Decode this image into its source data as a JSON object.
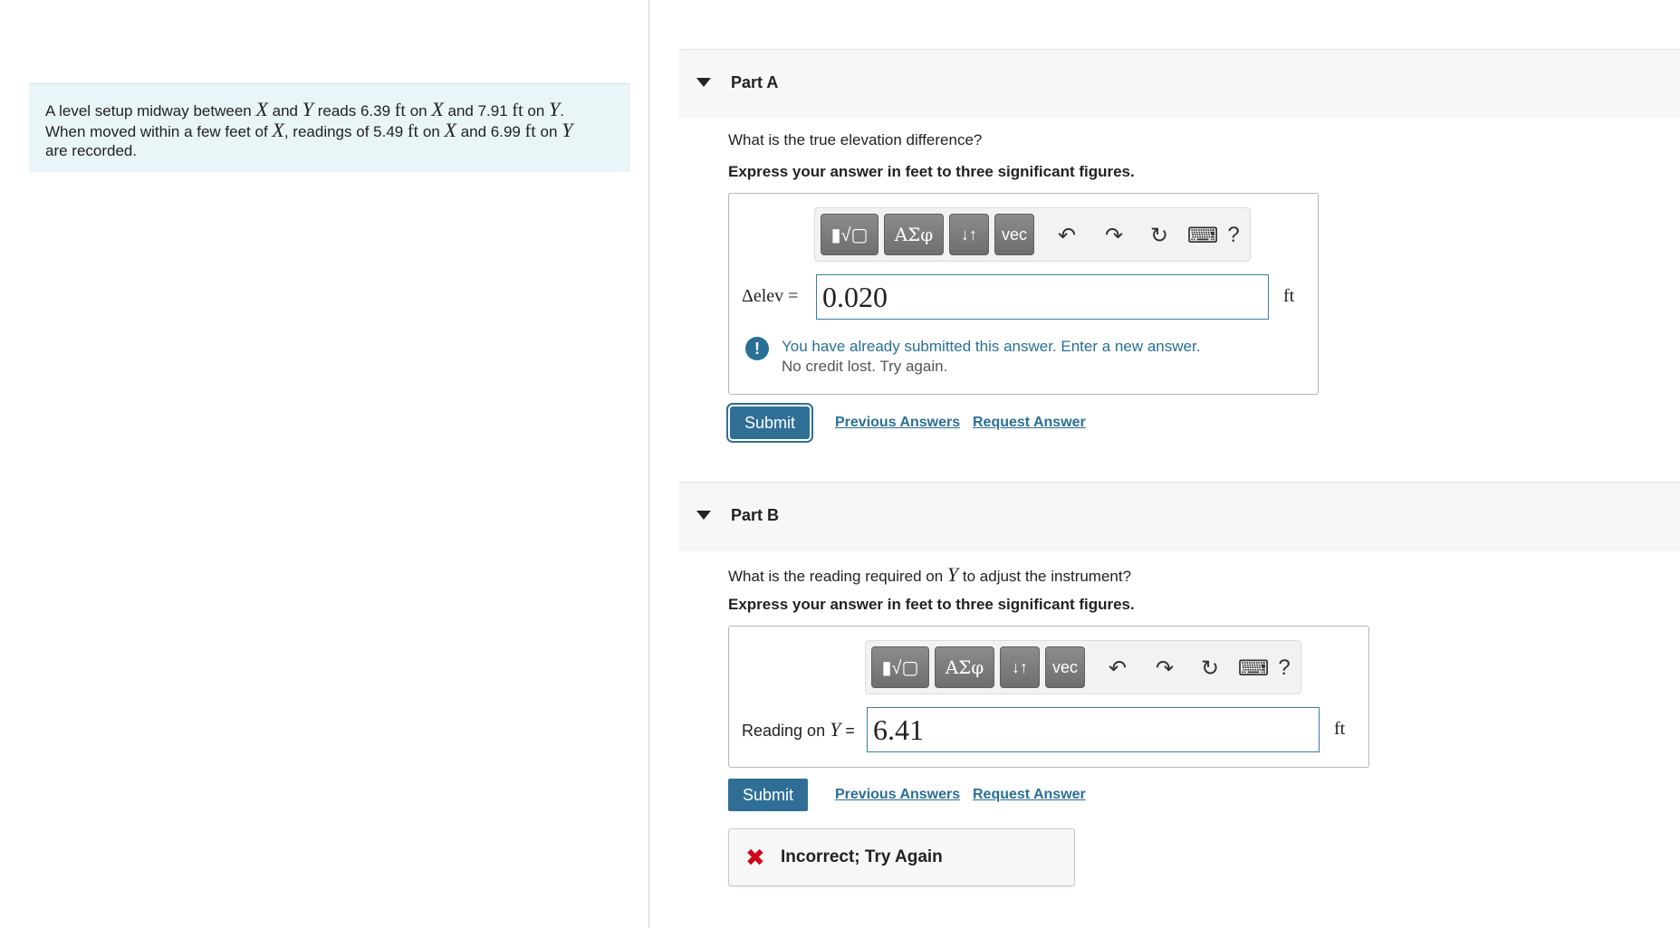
{
  "problem": {
    "t1": "A level setup midway between ",
    "X": "X",
    "t2": " and ",
    "Y": "Y",
    "t3": " reads 6.39 ",
    "ft": "ft",
    "t4": " on ",
    "t5": " and 7.91 ",
    "t6": ".",
    "t7": "When moved within a few feet of ",
    "t8": ", readings of 5.49 ",
    "t9": " and 6.99 ",
    "t10": "are recorded."
  },
  "toolbar": {
    "templates_glyph": "▮√▢",
    "greek_label": "ΑΣφ",
    "arrows_label": "↓↑",
    "vec_label": "vec",
    "undo_glyph": "↶",
    "redo_glyph": "↷",
    "reset_glyph": "↻",
    "keyboard_glyph": "⌨",
    "help_label": "?"
  },
  "partA": {
    "title": "Part A",
    "question": "What is the true elevation difference?",
    "instruction": "Express your answer in feet to three significant figures.",
    "lhs": "Δelev =",
    "value": "0.020",
    "unit": "ft",
    "notice_main": "You have already submitted this answer. Enter a new answer.",
    "notice_sub": "No credit lost. Try again.",
    "notice_icon": "!",
    "submit": "Submit",
    "previous": "Previous Answers",
    "request": "Request Answer"
  },
  "partB": {
    "title": "Part B",
    "question_pre": "What is the reading required on ",
    "question_var": "Y",
    "question_post": " to adjust the instrument?",
    "instruction": "Express your answer in feet to three significant figures.",
    "lhs_pre": "Reading on ",
    "lhs_var": "Y",
    "lhs_post": " =",
    "value": "6.41",
    "unit": "ft",
    "submit": "Submit",
    "previous": "Previous Answers",
    "request": "Request Answer",
    "feedback_icon": "✖",
    "feedback": "Incorrect; Try Again"
  },
  "colors": {
    "accent": "#2f6f96",
    "link": "#2a6f97",
    "error": "#d0021b",
    "problem_bg": "#eaf5f7"
  }
}
